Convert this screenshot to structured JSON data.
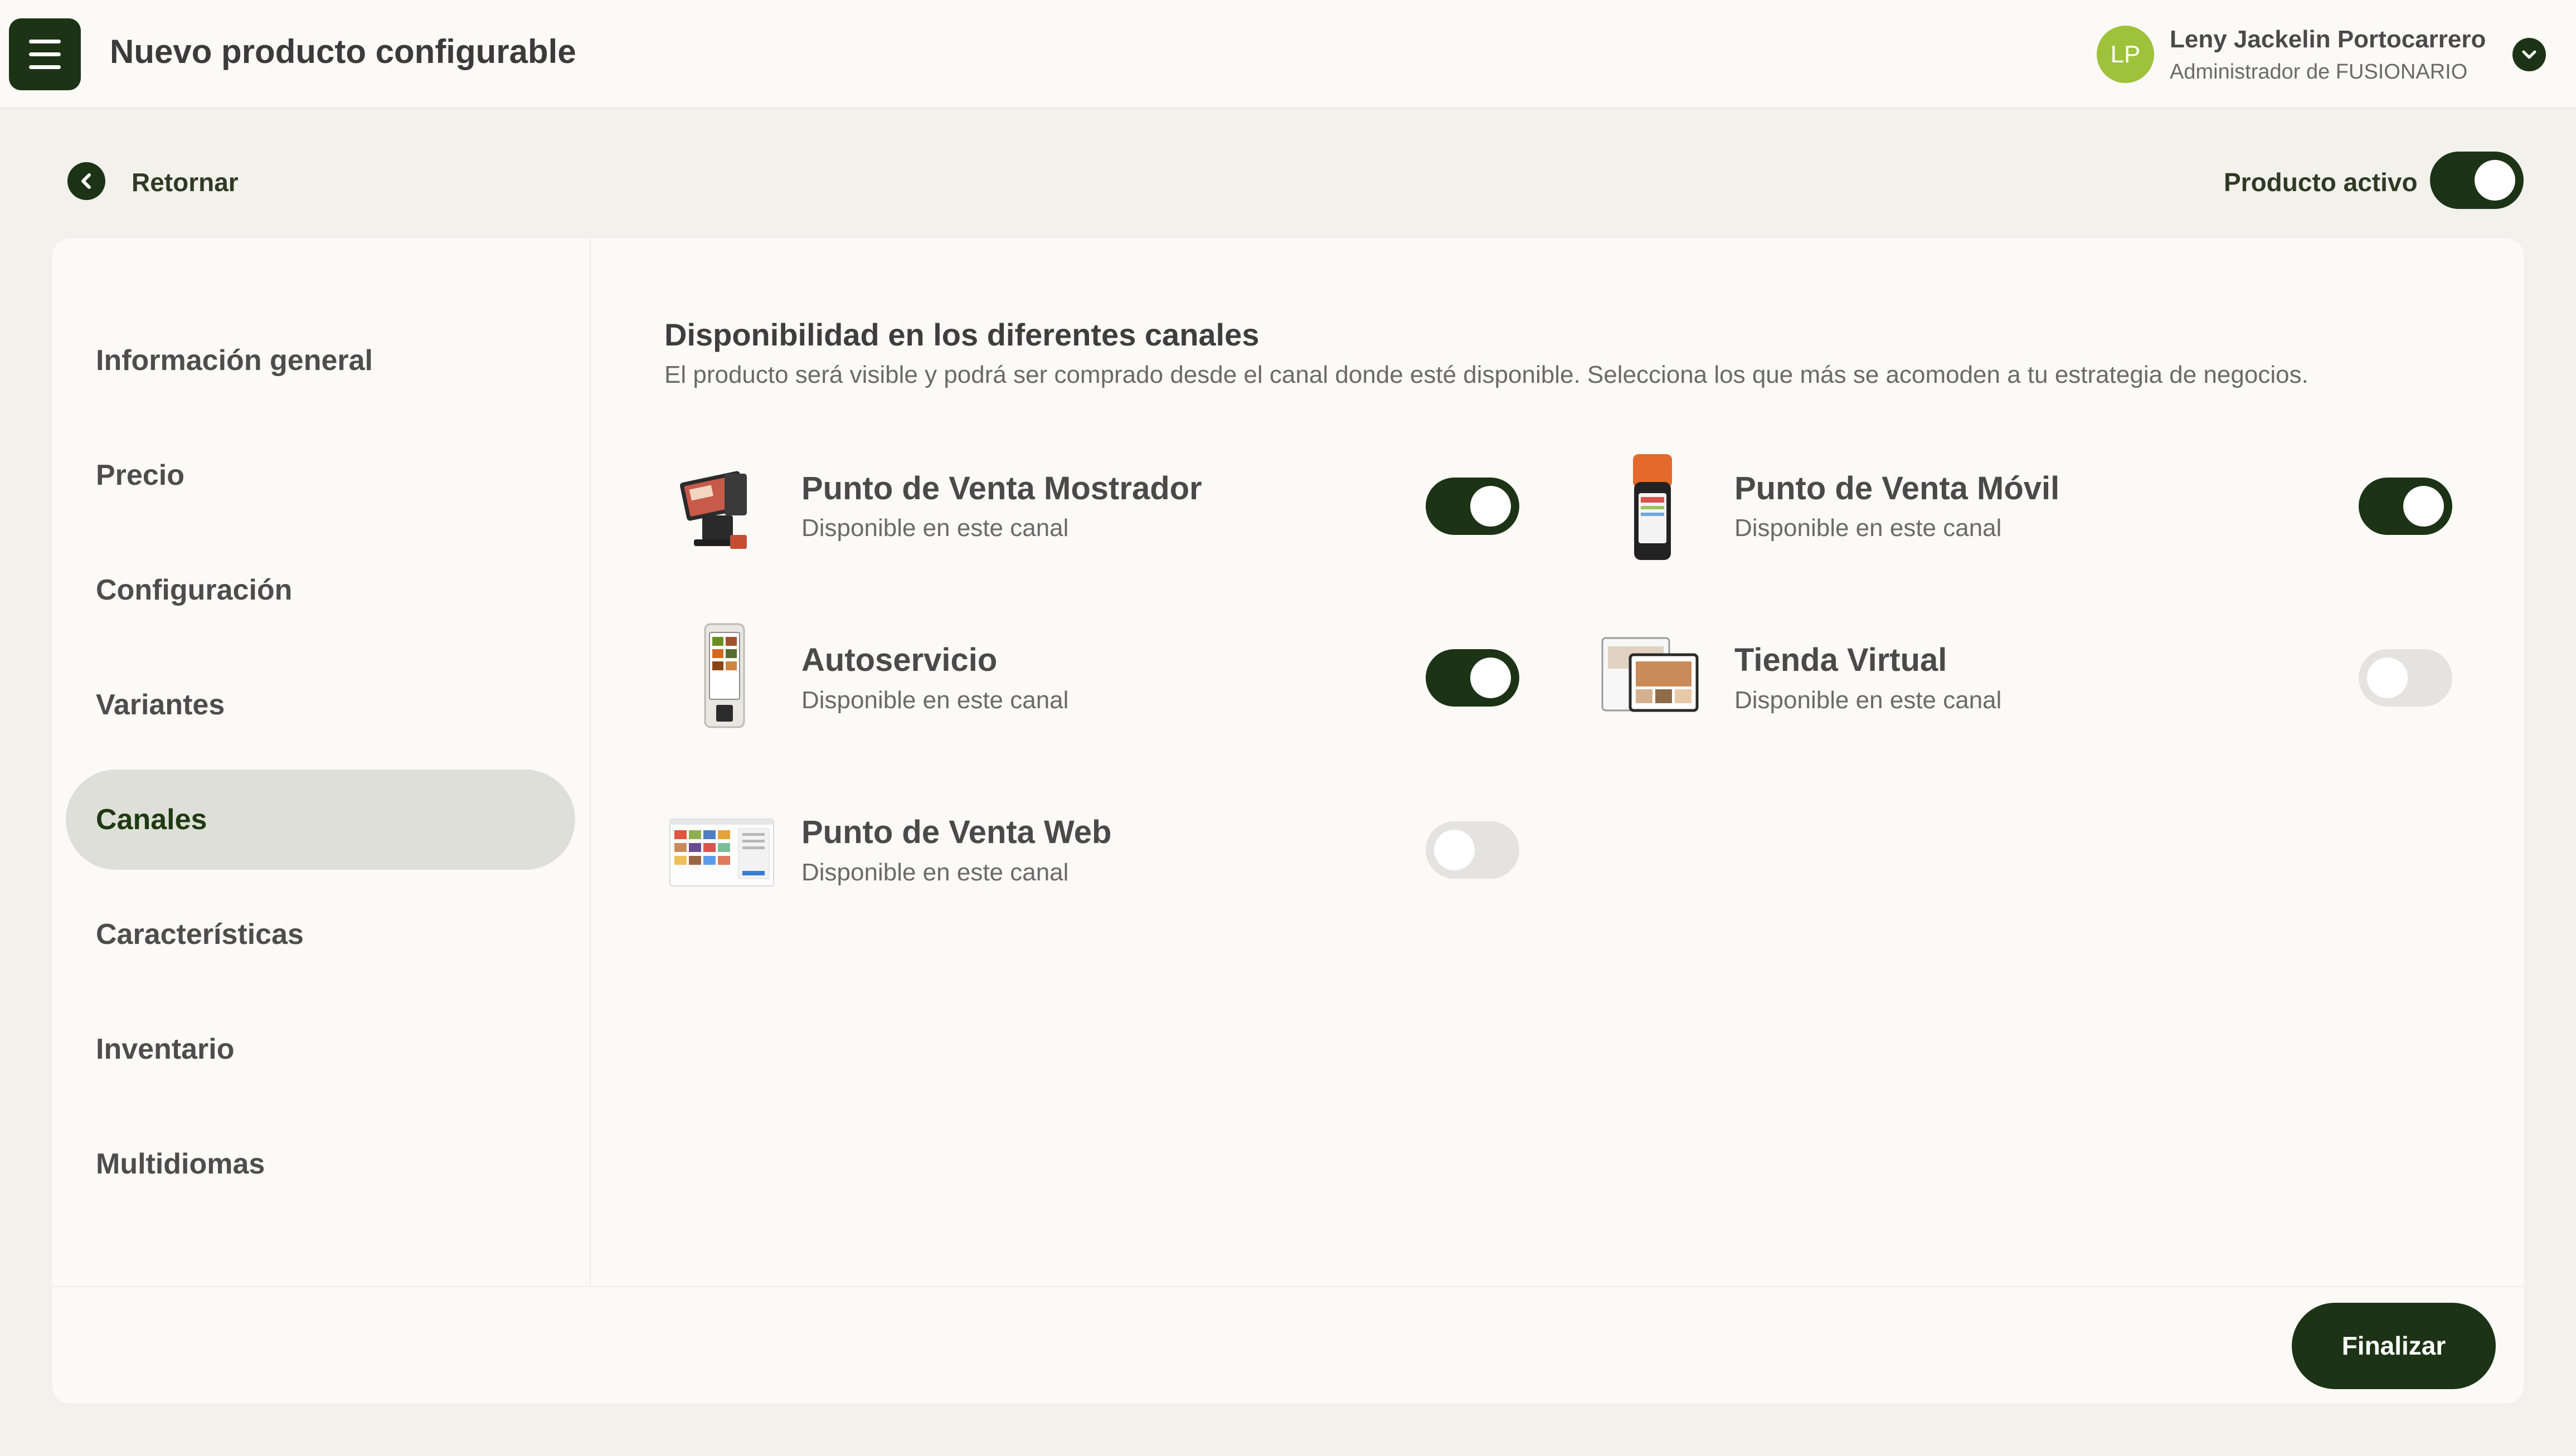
{
  "header": {
    "title": "Nuevo producto configurable",
    "menu_icon": "hamburger-icon",
    "user": {
      "initials": "LP",
      "name": "Leny Jackelin Portocarrero",
      "role": "Administrador de FUSIONARIO",
      "avatar_color": "#9ec23a"
    }
  },
  "toolbar": {
    "back_label": "Retornar",
    "active_label": "Producto activo",
    "active": true
  },
  "sidebar": {
    "items": [
      {
        "label": "Información general",
        "selected": false
      },
      {
        "label": "Precio",
        "selected": false
      },
      {
        "label": "Configuración",
        "selected": false
      },
      {
        "label": "Variantes",
        "selected": false
      },
      {
        "label": "Canales",
        "selected": true
      },
      {
        "label": "Características",
        "selected": false
      },
      {
        "label": "Inventario",
        "selected": false
      },
      {
        "label": "Multidiomas",
        "selected": false
      }
    ]
  },
  "section": {
    "title": "Disponibilidad en los diferentes canales",
    "description": "El producto será visible y podrá ser comprado desde el canal donde esté disponible. Selecciona los que más se acomoden a tu estrategia de negocios."
  },
  "channels": [
    {
      "name": "Punto de Venta Mostrador",
      "status": "Disponible en este canal",
      "enabled": true,
      "image": "pos-counter-terminal"
    },
    {
      "name": "Punto de Venta Móvil",
      "status": "Disponible en este canal",
      "enabled": true,
      "image": "mobile-pos-device"
    },
    {
      "name": "Autoservicio",
      "status": "Disponible en este canal",
      "enabled": true,
      "image": "self-service-kiosk"
    },
    {
      "name": "Tienda Virtual",
      "status": "Disponible en este canal",
      "enabled": false,
      "image": "online-store-devices"
    },
    {
      "name": "Punto de Venta Web",
      "status": "Disponible en este canal",
      "enabled": false,
      "image": "web-pos-screenshot"
    }
  ],
  "footer": {
    "finalize_label": "Finalizar"
  },
  "colors": {
    "primary": "#1c3315",
    "toggle_off": "#e4e3df",
    "selected_nav_bg": "#dfdfd9",
    "background": "#f2f1ec",
    "card": "#fbfaf7"
  }
}
